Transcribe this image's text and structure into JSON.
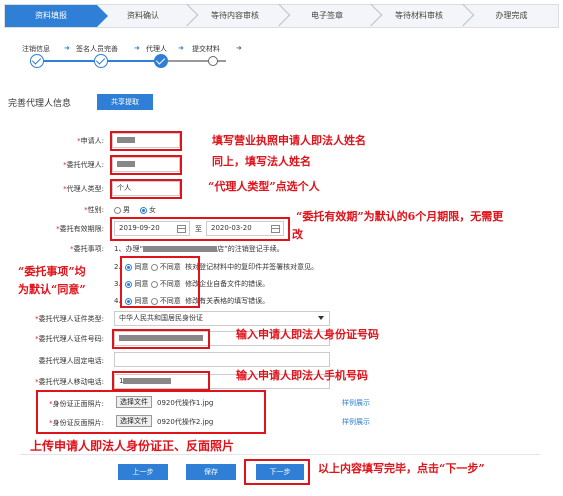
{
  "steps": [
    "资料填报",
    "资料确认",
    "等待内容审核",
    "电子签章",
    "等待材料审核",
    "办理完成"
  ],
  "substeps": [
    "注销信息",
    "签名人员完善",
    "代理人",
    "提交材料"
  ],
  "section_title": "完善代理人信息",
  "share_button": "共享提取",
  "form": {
    "applicant_label": "申请人:",
    "proxy_label": "委托代理人:",
    "proxy_type_label": "代理人类型:",
    "proxy_type_value": "个人",
    "gender_label": "性别:",
    "gender_male": "男",
    "gender_female": "女",
    "validity_label": "委托有效期限:",
    "date_from": "2019-09-20",
    "date_to": "2020-03-20",
    "date_sep": "至",
    "matters_label": "委托事项:",
    "matter_1_prefix": "1、办理“",
    "matter_1_suffix": "店”的注销登记手续。",
    "agree": "同意",
    "disagree": "不同意",
    "matters": [
      {
        "num": "2、",
        "text": "核对登记材料中的复印件并签署核对意见。"
      },
      {
        "num": "3、",
        "text": "修改企业自备文件的错误。"
      },
      {
        "num": "4、",
        "text": "修改有关表格的填写错误。"
      }
    ],
    "id_type_label": "委托代理人证件类型:",
    "id_type_value": "中华人民共和国居民身份证",
    "id_number_label": "委托代理人证件号码:",
    "phone_label": "委托代理人固定电话:",
    "mobile_label": "委托代理人移动电话:",
    "mobile_prefix": "1",
    "id_front_label": "身份证正面照片:",
    "id_back_label": "身份证反面照片:",
    "choose_file": "选择文件",
    "file_front": "0920代操作1.jpg",
    "file_back": "0920代操作2.jpg",
    "example": "样例展示"
  },
  "buttons": {
    "prev": "上一步",
    "save": "保存",
    "next": "下一步"
  },
  "annotations": {
    "a1": "填写营业执照申请人即法人姓名",
    "a2": "同上，填写法人姓名",
    "a3": "“代理人类型”点选个人",
    "a4": "“委托有效期”为默认的6个月期限，无需更",
    "a4b": "改",
    "a5a": "“委托事项”均",
    "a5b": "为默认“同意”",
    "a6": "输入申请人即法人身份证号码",
    "a7": "输入申请人即法人手机号码",
    "a8": "上传申请人即法人身份证正、反面照片",
    "a9": "以上内容填写完毕，点击“下一步”"
  },
  "colors": {
    "primary": "#2f7fd6",
    "annotation": "#e0121a"
  }
}
